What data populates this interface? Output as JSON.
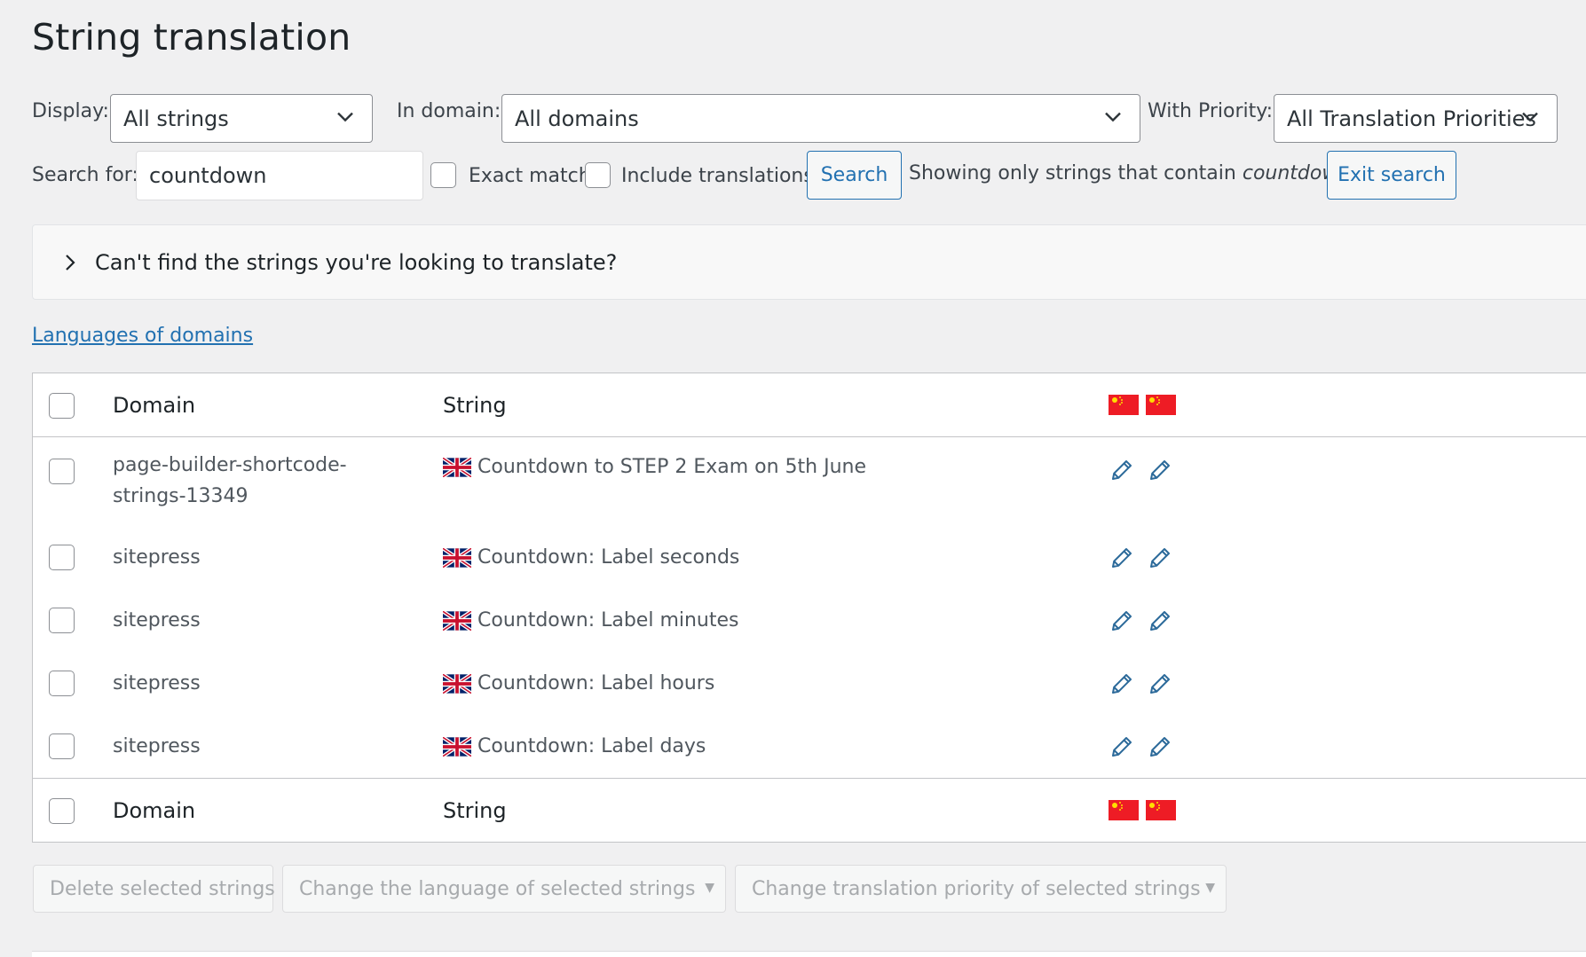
{
  "page_title": "String translation",
  "filters": {
    "display_label": "Display:",
    "display_value": "All strings",
    "domain_label": "In domain:",
    "domain_value": "All domains",
    "priority_label": "With Priority:",
    "priority_value": "All Translation Priorities"
  },
  "search": {
    "label": "Search for:",
    "value": "countdown",
    "exact_match_label": "Exact match",
    "exact_match_checked": false,
    "include_translations_label": "Include translations",
    "include_translations_checked": false,
    "search_button": "Search",
    "notice_prefix": "Showing only strings that contain",
    "notice_term": "countdown",
    "exit_button": "Exit search"
  },
  "help_panel": {
    "text": "Can't find the strings you're looking to translate?"
  },
  "languages_link": "Languages of domains",
  "table": {
    "header": {
      "domain": "Domain",
      "string": "String"
    },
    "footer": {
      "domain": "Domain",
      "string": "String"
    },
    "language_flags": [
      "china-flag-icon",
      "china-flag-icon"
    ],
    "rows": [
      {
        "domain": "page-builder-shortcode-strings-13349",
        "string": "Countdown to STEP 2 Exam on 5th June",
        "source_flag": "uk-flag-icon"
      },
      {
        "domain": "sitepress",
        "string": "Countdown: Label seconds",
        "source_flag": "uk-flag-icon"
      },
      {
        "domain": "sitepress",
        "string": "Countdown: Label minutes",
        "source_flag": "uk-flag-icon"
      },
      {
        "domain": "sitepress",
        "string": "Countdown: Label hours",
        "source_flag": "uk-flag-icon"
      },
      {
        "domain": "sitepress",
        "string": "Countdown: Label days",
        "source_flag": "uk-flag-icon"
      }
    ]
  },
  "bulk_actions": {
    "delete": "Delete selected strings",
    "change_language": "Change the language of selected strings",
    "change_priority": "Change translation priority of selected strings"
  },
  "colors": {
    "accent": "#2271b1",
    "background": "#f0f0f1",
    "disabled_text": "#a7aaad"
  }
}
